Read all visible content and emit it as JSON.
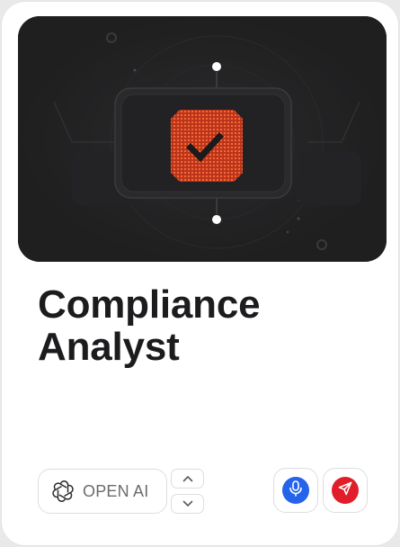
{
  "card": {
    "title_line1": "Compliance",
    "title_line2": "Analyst",
    "hero_icon": "checkmark-badge-icon"
  },
  "controls": {
    "provider_label": "OPEN AI",
    "provider_icon": "openai-logo-icon",
    "stepper_up_icon": "chevron-up-icon",
    "stepper_down_icon": "chevron-down-icon",
    "mic_icon": "microphone-icon",
    "send_icon": "send-icon"
  },
  "colors": {
    "hero_background": "#1f1f20",
    "badge_orange": "#f0532a",
    "mic_blue": "#2563eb",
    "send_red": "#e11d2a",
    "title_text": "#1c1c1e",
    "label_text": "#6b6b70"
  }
}
